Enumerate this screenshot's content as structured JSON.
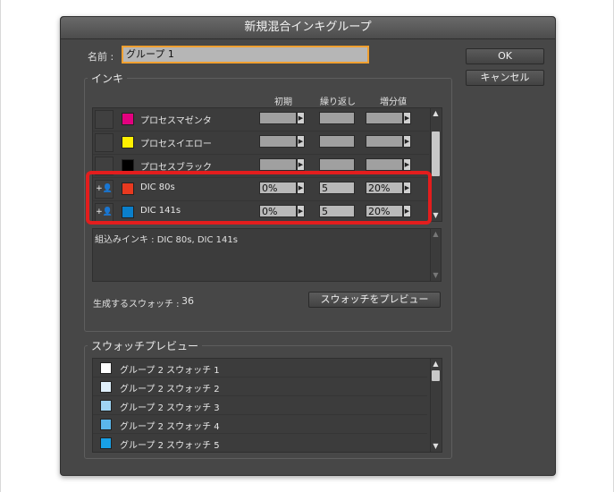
{
  "dialog": {
    "title": "新規混合インキグループ",
    "name_label": "名前 :",
    "name_value": "グループ 1",
    "ok_label": "OK",
    "cancel_label": "キャンセル"
  },
  "inks": {
    "group_title": "インキ",
    "col_initial": "初期",
    "col_repeat": "繰り返し",
    "col_increment": "増分値",
    "rows": [
      {
        "name": "プロセスマゼンタ",
        "color": "#e3007f",
        "initial": "",
        "repeat": "",
        "increment": ""
      },
      {
        "name": "プロセスイエロー",
        "color": "#fff000",
        "initial": "",
        "repeat": "",
        "increment": ""
      },
      {
        "name": "プロセスブラック",
        "color": "#000000",
        "initial": "",
        "repeat": "",
        "increment": ""
      },
      {
        "name": "DIC 80s",
        "color": "#e8391f",
        "initial": "0%",
        "repeat": "5",
        "increment": "20%"
      },
      {
        "name": "DIC 141s",
        "color": "#0a7fcb",
        "initial": "0%",
        "repeat": "5",
        "increment": "20%"
      }
    ],
    "included_text": "組込みインキ : DIC 80s, DIC 141s",
    "swatch_count_label": "生成するスウォッチ :",
    "swatch_count": "36",
    "preview_button": "スウォッチをプレビュー"
  },
  "preview": {
    "group_title": "スウォッチプレビュー",
    "items": [
      {
        "name": "グループ 2 スウォッチ 1",
        "color": "#ffffff"
      },
      {
        "name": "グループ 2 スウォッチ 2",
        "color": "#e0f0fb"
      },
      {
        "name": "グループ 2 スウォッチ 3",
        "color": "#9fd4f3"
      },
      {
        "name": "グループ 2 スウォッチ 4",
        "color": "#5bb7ec"
      },
      {
        "name": "グループ 2 スウォッチ 5",
        "color": "#18a0e6"
      }
    ]
  },
  "colors": {
    "dialog_bg": "#474747",
    "highlight": "#e31d1d",
    "name_focus": "#f0a030"
  }
}
